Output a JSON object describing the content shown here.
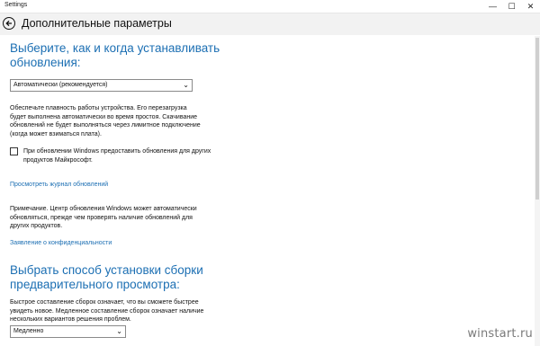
{
  "window": {
    "title": "Settings",
    "controls": {
      "minimize": "—",
      "maximize": "☐",
      "close": "✕"
    }
  },
  "header": {
    "back_icon": "back-arrow-icon",
    "title": "Дополнительные параметры"
  },
  "updates": {
    "heading": "Выберите, как и когда устанавливать обновления:",
    "mode": {
      "value": "Автоматически (рекомендуется)",
      "chevron": "⌄"
    },
    "description": "Обеспечьте плавность работы устройства. Его перезагрузка будет выполнена автоматически во время простоя. Скачивание обновлений не будет выполняться через лимитное подключение (когда может взиматься плата).",
    "other_products_checkbox": {
      "checked": false,
      "label": "При обновлении Windows предоставить обновления для других продуктов Майкрософт."
    },
    "history_link": "Просмотреть журнал обновлений",
    "note": "Примечание. Центр обновления Windows может автоматически обновляться, прежде чем проверять наличие обновлений для других продуктов.",
    "privacy_link": "Заявление о конфиденциальности"
  },
  "preview": {
    "heading": "Выбрать способ установки сборки предварительного просмотра:",
    "description": "Быстрое составление сборок означает, что вы сможете быстрее увидеть новое. Медленное составление сборок означает наличие нескольких вариантов решения проблем.",
    "speed": {
      "value": "Медленно",
      "chevron": "⌄"
    }
  },
  "watermark": "winstart.ru",
  "colors": {
    "accent": "#1c6fb3",
    "header_bg": "#f2f2f2"
  }
}
